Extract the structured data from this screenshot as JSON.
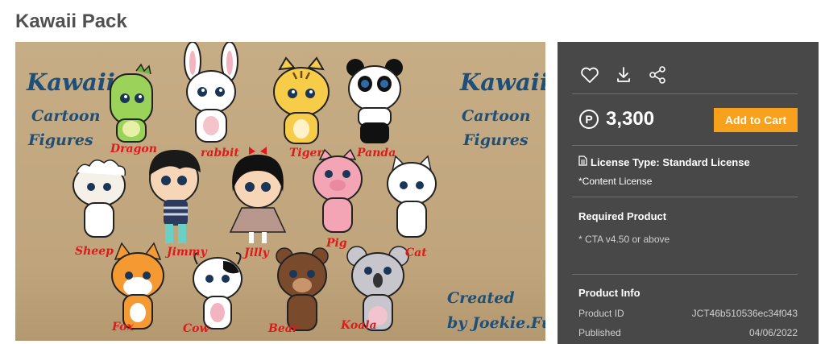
{
  "product": {
    "title": "Kawaii Pack"
  },
  "preview": {
    "left_heading": [
      "Kawaii",
      "Cartoon",
      "Figures"
    ],
    "right_heading": [
      "Kawaii",
      "Cartoon",
      "Figures"
    ],
    "credit": [
      "Created",
      "by Joekie.Fun"
    ],
    "characters": [
      "Dragon",
      "rabbit",
      "Tiger",
      "Panda",
      "Sheep",
      "Jimmy",
      "Jilly",
      "Pig",
      "Cat",
      "Fox",
      "Cow",
      "Bear",
      "Koala"
    ]
  },
  "actions": {
    "icons": [
      "heart-icon",
      "download-icon",
      "share-icon"
    ]
  },
  "price": {
    "currency_symbol": "P",
    "amount": "3,300",
    "add_to_cart_label": "Add to Cart"
  },
  "license": {
    "type_label": "License Type: Standard License",
    "content_label": "*Content License"
  },
  "required": {
    "title": "Required Product",
    "item": "* CTA v4.50 or above"
  },
  "info": {
    "title": "Product Info",
    "id_label": "Product ID",
    "id_value": "JCT46b510536ec34f043",
    "published_label": "Published",
    "published_value": "04/06/2022"
  },
  "colors": {
    "accent": "#f7a11c",
    "panel": "#484848",
    "heading_blue": "#1e4f78",
    "label_red": "#e0191c"
  }
}
